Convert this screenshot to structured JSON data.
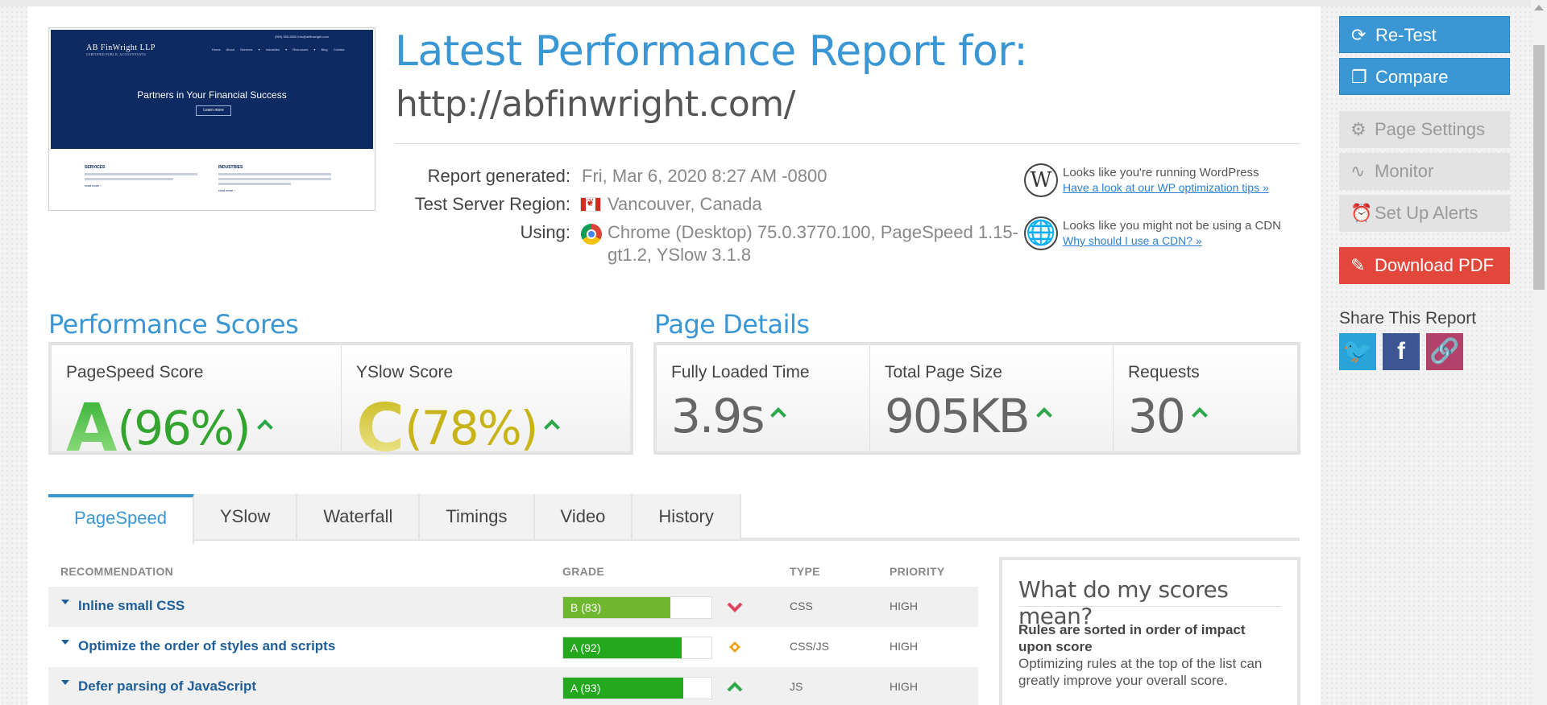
{
  "thumbnail": {
    "logo": "AB FinWright LLP",
    "logo_sub": "CERTIFIED PUBLIC ACCOUNTANTS",
    "topbar": "(555) 555-5555   info@abfinwright.com",
    "nav": "Home About Services ▾ Industries ▾ Resources ▾ Blog Contact",
    "tagline": "Partners in Your Financial Success",
    "button": "Learn more",
    "col1_title": "SERVICES",
    "col2_title": "INDUSTRIES",
    "col_link": "read more ›"
  },
  "header": {
    "title": "Latest Performance Report for:",
    "url": "http://abfinwright.com/"
  },
  "meta": {
    "generated_label": "Report generated:",
    "generated_value": "Fri, Mar 6, 2020 8:27 AM -0800",
    "region_label": "Test Server Region:",
    "region_value": "Vancouver, Canada",
    "using_label": "Using:",
    "using_line1": "Chrome (Desktop) 75.0.3770.100, PageSpeed 1.15-",
    "using_line2": "gt1.2, YSlow 3.1.8"
  },
  "hints": {
    "wp_text": "Looks like you're running WordPress",
    "wp_link": "Have a look at our WP optimization tips »",
    "cdn_text": "Looks like you might not be using a CDN",
    "cdn_link": "Why should I use a CDN? »"
  },
  "performance": {
    "title": "Performance Scores",
    "pagespeed_label": "PageSpeed Score",
    "pagespeed_grade": "A",
    "pagespeed_pct": "(96%)",
    "yslow_label": "YSlow Score",
    "yslow_grade": "C",
    "yslow_pct": "(78%)"
  },
  "details": {
    "title": "Page Details",
    "loaded_label": "Fully Loaded Time",
    "loaded_value": "3.9s",
    "size_label": "Total Page Size",
    "size_value": "905KB",
    "requests_label": "Requests",
    "requests_value": "30"
  },
  "tabs": [
    "PageSpeed",
    "YSlow",
    "Waterfall",
    "Timings",
    "Video",
    "History"
  ],
  "table": {
    "headers": {
      "recommendation": "RECOMMENDATION",
      "grade": "GRADE",
      "type": "TYPE",
      "priority": "PRIORITY"
    },
    "rows": [
      {
        "name": "Inline small CSS",
        "grade": "B (83)",
        "score": 83,
        "type": "CSS",
        "priority": "HIGH",
        "trend": "down",
        "color": "#6fb72f"
      },
      {
        "name": "Optimize the order of styles and scripts",
        "grade": "A (92)",
        "score": 92,
        "type": "CSS/JS",
        "priority": "HIGH",
        "trend": "same",
        "color": "#24a81e"
      },
      {
        "name": "Defer parsing of JavaScript",
        "grade": "A (93)",
        "score": 93,
        "type": "JS",
        "priority": "HIGH",
        "trend": "up",
        "color": "#24a81e"
      }
    ]
  },
  "scores_mean": {
    "title": "What do my scores mean?",
    "bold": "Rules are sorted in order of impact upon score",
    "text": "Optimizing rules at the top of the list can greatly improve your overall score."
  },
  "sidebar": {
    "retest": "Re-Test",
    "compare": "Compare",
    "page_settings": "Page Settings",
    "monitor": "Monitor",
    "alerts": "Set Up Alerts",
    "download": "Download PDF",
    "share_title": "Share This Report"
  },
  "colors": {
    "accent": "#3a97d4",
    "grade_a": "#33a52f",
    "grade_c": "#c8b318",
    "download": "#e2473b",
    "twitter": "#2aa3d9",
    "facebook": "#3b5692",
    "link": "#b3426b"
  }
}
